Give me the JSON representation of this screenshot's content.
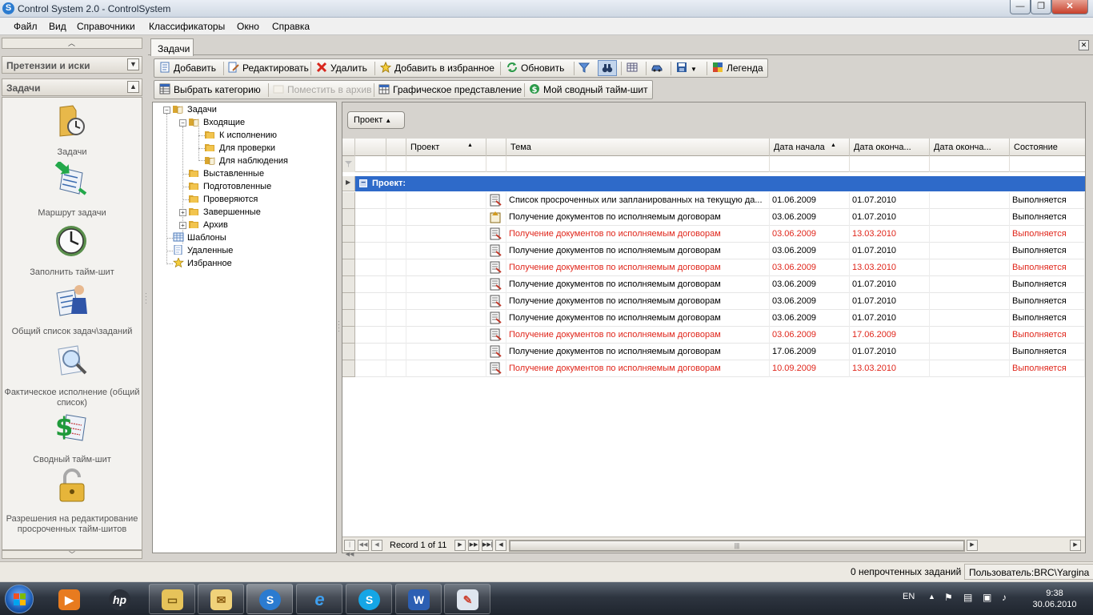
{
  "window": {
    "title": "Control System 2.0 - ControlSystem",
    "app_icon_letter": "S",
    "min_glyph": "—",
    "max_glyph": "❐",
    "close_glyph": "✕"
  },
  "menu": [
    "Файл",
    "Вид",
    "Справочники",
    "Классификаторы",
    "Окно",
    "Справка"
  ],
  "sidebar": {
    "section_claims": "Претензии и иски",
    "section_tasks": "Задачи",
    "items": [
      {
        "label": "Задачи",
        "icon": "folder-clock-icon"
      },
      {
        "label": "Маршрут задачи",
        "icon": "task-route-icon"
      },
      {
        "label": "Заполнить тайм-шит",
        "icon": "clock-icon"
      },
      {
        "label": "Общий список задач\\заданий",
        "icon": "user-list-icon"
      },
      {
        "label": "Фактическое исполнение (общий список)",
        "icon": "magnifier-icon"
      },
      {
        "label": "Сводный тайм-шит",
        "icon": "dollar-sheet-icon"
      },
      {
        "label": "Разрешения на редактирование просроченных тайм-шитов",
        "icon": "lock-icon"
      }
    ]
  },
  "tab": {
    "label": "Задачи",
    "close_glyph": "✕"
  },
  "toolbar1": {
    "add": "Добавить",
    "edit": "Редактировать",
    "delete": "Удалить",
    "add_favorite": "Добавить в избранное",
    "refresh": "Обновить",
    "legend": "Легенда"
  },
  "toolbar2": {
    "select_category": "Выбрать категорию",
    "archive": "Поместить в архив",
    "graphic_view": "Графическое представление",
    "my_timesheet": "Мой сводный тайм-шит"
  },
  "tree": {
    "root": "Задачи",
    "incoming": "Входящие",
    "in_progress": "К исполнению",
    "for_review": "Для проверки",
    "for_watch": "Для наблюдения",
    "issued": "Выставленные",
    "prepared": "Подготовленные",
    "checking": "Проверяются",
    "completed": "Завершенные",
    "archive": "Архив",
    "templates": "Шаблоны",
    "deleted": "Удаленные",
    "favorites": "Избранное"
  },
  "grid": {
    "group_chip": "Проект",
    "columns": [
      "Проект",
      "Тема",
      "Дата начала",
      "Дата оконча...",
      "Дата оконча...",
      "Состояние"
    ],
    "group_label": "Проект:",
    "rows": [
      {
        "topic": "Список просроченных или запланированных на текущую да...",
        "start": "01.06.2009",
        "end1": "01.07.2010",
        "end2": "",
        "state": "Выполняется",
        "red": false
      },
      {
        "topic": "Получение документов по исполняемым договорам",
        "start": "03.06.2009",
        "end1": "01.07.2010",
        "end2": "",
        "state": "Выполняется",
        "red": false
      },
      {
        "topic": "Получение документов по исполняемым договорам",
        "start": "03.06.2009",
        "end1": "13.03.2010",
        "end2": "",
        "state": "Выполняется",
        "red": true
      },
      {
        "topic": "Получение документов по исполняемым договорам",
        "start": "03.06.2009",
        "end1": "01.07.2010",
        "end2": "",
        "state": "Выполняется",
        "red": false
      },
      {
        "topic": "Получение документов по исполняемым договорам",
        "start": "03.06.2009",
        "end1": "13.03.2010",
        "end2": "",
        "state": "Выполняется",
        "red": true
      },
      {
        "topic": "Получение документов по исполняемым договорам",
        "start": "03.06.2009",
        "end1": "01.07.2010",
        "end2": "",
        "state": "Выполняется",
        "red": false
      },
      {
        "topic": "Получение документов по исполняемым договорам",
        "start": "03.06.2009",
        "end1": "01.07.2010",
        "end2": "",
        "state": "Выполняется",
        "red": false
      },
      {
        "topic": "Получение документов по исполняемым договорам",
        "start": "03.06.2009",
        "end1": "01.07.2010",
        "end2": "",
        "state": "Выполняется",
        "red": false
      },
      {
        "topic": "Получение документов по исполняемым договорам",
        "start": "03.06.2009",
        "end1": "17.06.2009",
        "end2": "",
        "state": "Выполняется",
        "red": true
      },
      {
        "topic": "Получение документов по исполняемым договорам",
        "start": "17.06.2009",
        "end1": "01.07.2010",
        "end2": "",
        "state": "Выполняется",
        "red": false
      },
      {
        "topic": "Получение документов по исполняемым договорам",
        "start": "10.09.2009",
        "end1": "13.03.2010",
        "end2": "",
        "state": "Выполняется",
        "red": true
      }
    ],
    "record_text": "Record 1 of 11"
  },
  "status": {
    "unread": "0 непрочтенных заданий",
    "user": "Пользователь:BRC\\Yargina"
  },
  "taskbar": {
    "language": "EN",
    "time": "9:38",
    "date": "30.06.2010"
  },
  "colors": {
    "accent_group": "#2e6ac9",
    "overdue_text": "#e0261b"
  }
}
